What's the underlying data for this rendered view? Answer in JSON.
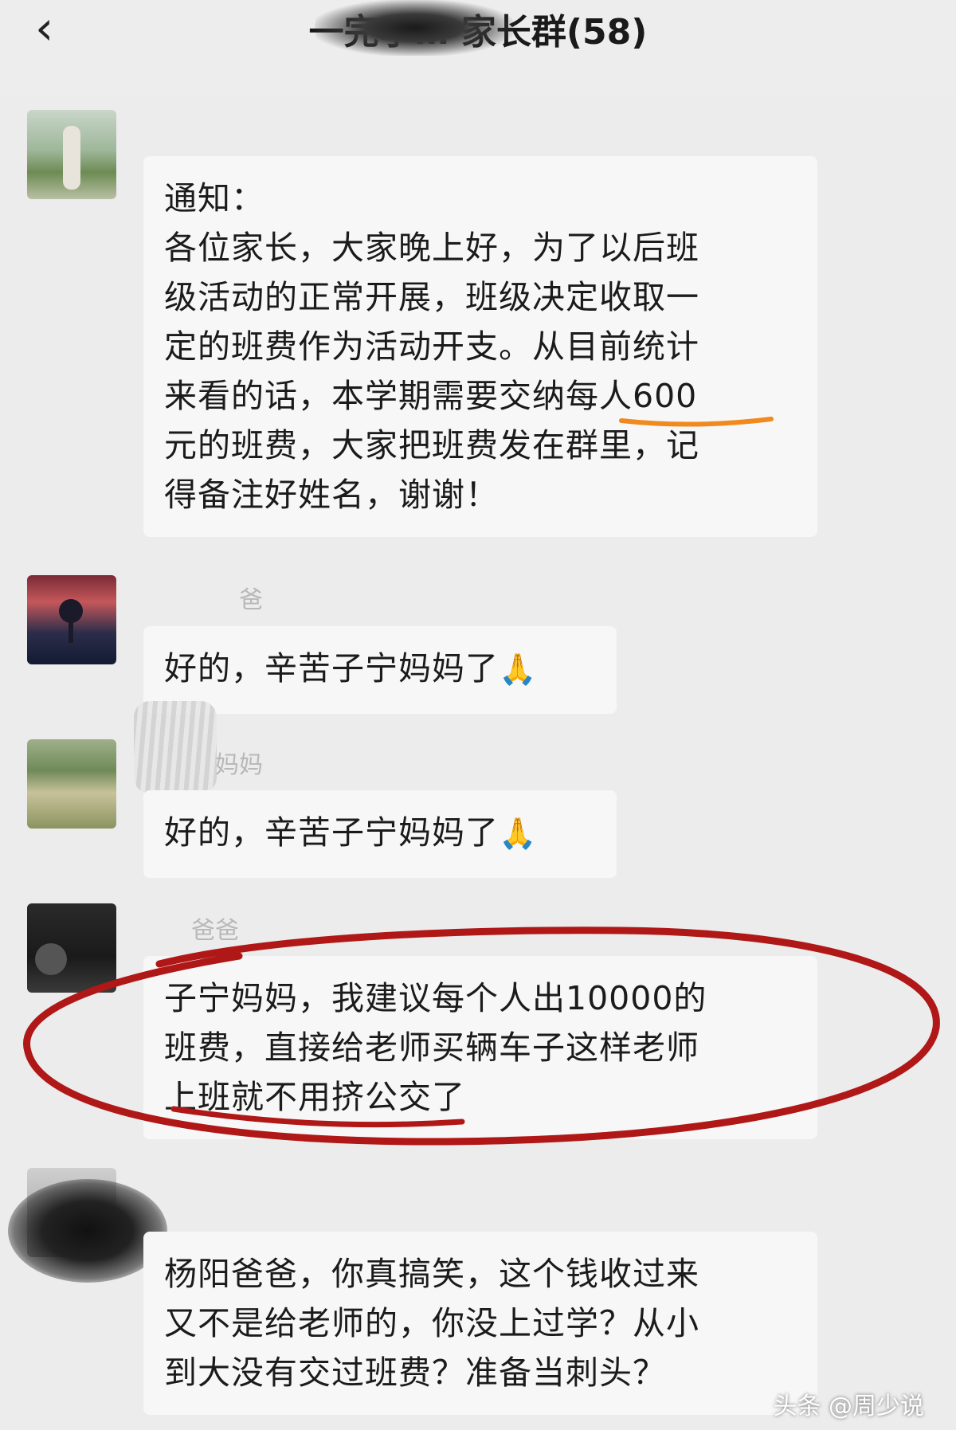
{
  "header": {
    "back_icon": "chevron-left-icon",
    "title": "一完小… 家长群(58)"
  },
  "messages": [
    {
      "sender": "",
      "lines": [
        "通知：",
        "各位家长，大家晚上好，为了以后班",
        "级活动的正常开展，班级决定收取一",
        "定的班费作为活动开支。从目前统计",
        "来看的话，本学期需要交纳每人600",
        "元的班费，大家把班费发在群里，记",
        "得备注好姓名，谢谢！"
      ]
    },
    {
      "sender": "爸",
      "lines": [
        "好的，辛苦子宁妈妈了"
      ],
      "emoji_icon": "praying-hands-icon"
    },
    {
      "sender": "妈妈",
      "lines": [
        "好的，辛苦子宁妈妈了"
      ],
      "emoji_icon": "praying-hands-icon"
    },
    {
      "sender": "爸爸",
      "lines": [
        "子宁妈妈，我建议每个人出10000的",
        "班费，直接给老师买辆车子这样老师",
        "上班就不用挤公交了"
      ]
    },
    {
      "sender": "",
      "lines": [
        "杨阳爸爸，你真搞笑，这个钱收过来",
        "又不是给老师的，你没上过学？从小",
        "到大没有交过班费？准备当刺头？"
      ]
    }
  ],
  "watermark": "头条 @周少说",
  "colors": {
    "background": "#ececec",
    "bubble": "#f7f7f7",
    "underline": "#f08a1e",
    "circle": "#b01818"
  }
}
